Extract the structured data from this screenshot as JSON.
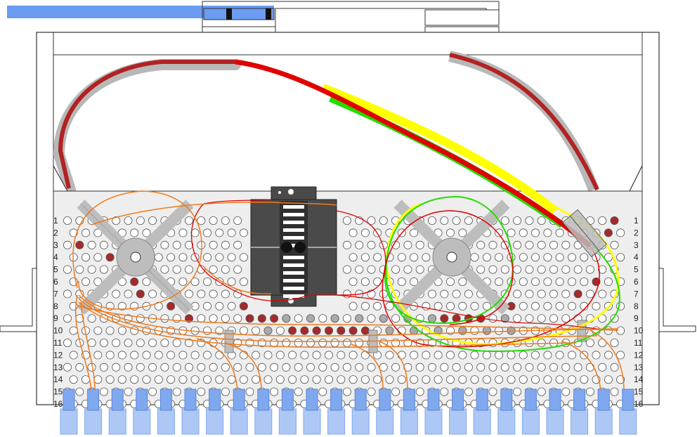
{
  "row_numbers": [
    "1",
    "2",
    "3",
    "4",
    "5",
    "6",
    "7",
    "8",
    "9",
    "10",
    "11",
    "12",
    "13",
    "14",
    "15",
    "16"
  ],
  "colors": {
    "tray_outline": "#333333",
    "panel_fill": "#eeeeee",
    "hole_fill": "#ffffff",
    "hole_filled": "#a52a2a",
    "hole_gray": "#aaaaaa",
    "reel_gray": "#bdbdbd",
    "splice_holder": "#4a4a4a",
    "port_blue": "#7fa8ef",
    "port_blue_light": "#aec8f5",
    "fiber_red": "#e00000",
    "fiber_yellow": "#ffff00",
    "fiber_green": "#22dd00",
    "fiber_orange": "#f07a1a",
    "cable_dark_red": "#b22222",
    "cable_gray": "#b8b8b8",
    "rail_blue": "#6b9cf2"
  },
  "components": {
    "ports": 24,
    "reels": 2,
    "splice_holder": 1,
    "fiber_colors": [
      "red",
      "yellow",
      "green",
      "orange"
    ]
  }
}
